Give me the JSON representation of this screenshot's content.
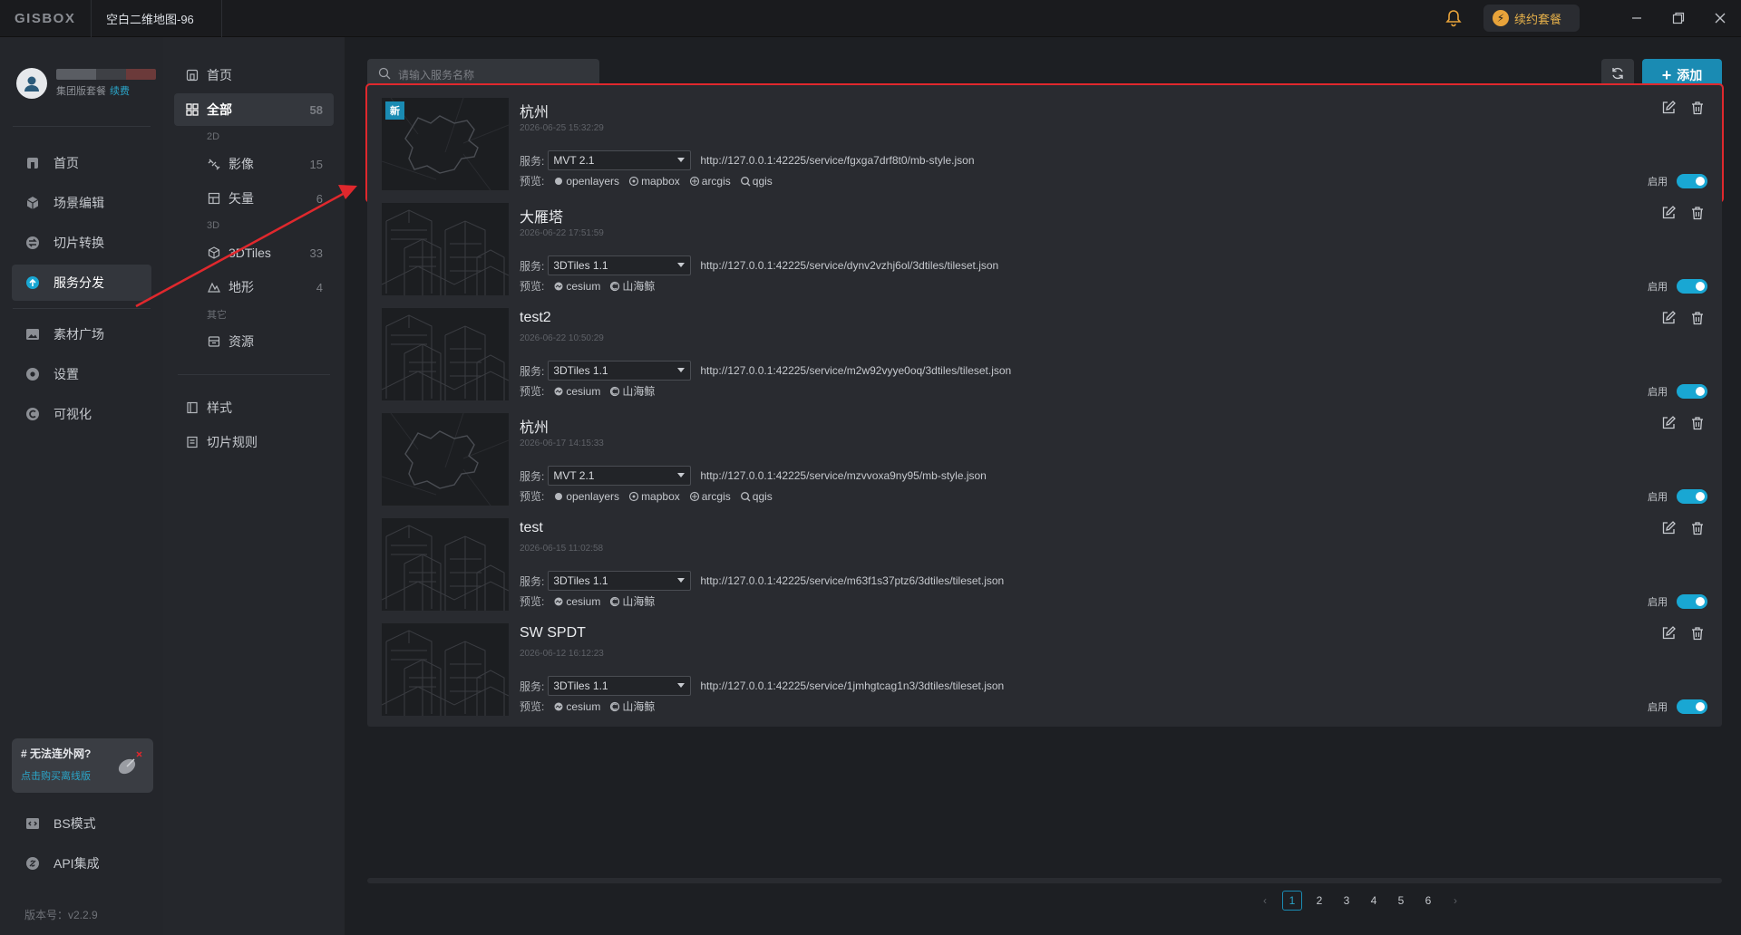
{
  "titlebar": {
    "logo": "GISBOX",
    "doc_tab": "空白二维地图-96",
    "renew_label": "续约套餐"
  },
  "user": {
    "plan": "集团版套餐",
    "renew_link": "续费"
  },
  "leftnav": {
    "items": [
      {
        "label": "首页",
        "icon": "home-icon"
      },
      {
        "label": "场景编辑",
        "icon": "cube-icon"
      },
      {
        "label": "切片转换",
        "icon": "swap-icon"
      },
      {
        "label": "服务分发",
        "icon": "upload-cloud-icon"
      },
      {
        "label": "素材广场",
        "icon": "image-icon"
      },
      {
        "label": "设置",
        "icon": "gear-icon"
      },
      {
        "label": "可视化",
        "icon": "chart-icon"
      }
    ],
    "bottom_items": [
      {
        "label": "BS模式",
        "icon": "code-icon"
      },
      {
        "label": "API集成",
        "icon": "link-icon"
      }
    ],
    "offline_card": {
      "title": "# 无法连外网?",
      "link": "点击购买离线版"
    },
    "version": "版本号：v2.2.9"
  },
  "categories": {
    "home": "首页",
    "all": {
      "label": "全部",
      "count": "58"
    },
    "group_2d": "2D",
    "imagery": {
      "label": "影像",
      "count": "15"
    },
    "vector": {
      "label": "矢量",
      "count": "6"
    },
    "group_3d": "3D",
    "tiles3d": {
      "label": "3DTiles",
      "count": "33"
    },
    "terrain": {
      "label": "地形",
      "count": "4"
    },
    "group_other": "其它",
    "resource": {
      "label": "资源"
    },
    "style": "样式",
    "tile_rules": "切片规则"
  },
  "toolbar": {
    "search_placeholder": "请输入服务名称",
    "add_label": "添加"
  },
  "labels": {
    "service": "服务:",
    "preview": "预览:",
    "enable": "启用"
  },
  "services": [
    {
      "title": "杭州",
      "date": "2026-06-25 15:32:29",
      "type": "MVT 2.1",
      "thumb": "map",
      "url": "http://127.0.0.1:42225/service/fgxga7drf8t0/mb-style.json",
      "previews": [
        "openlayers",
        "mapbox",
        "arcgis",
        "qgis"
      ],
      "is_new": true,
      "enabled": true
    },
    {
      "title": "大雁塔",
      "date": "2026-06-22 17:51:59",
      "type": "3DTiles 1.1",
      "thumb": "city",
      "url": "http://127.0.0.1:42225/service/dynv2vzhj6ol/3dtiles/tileset.json",
      "previews": [
        "cesium",
        "山海鲸"
      ],
      "is_new": false,
      "enabled": true
    },
    {
      "title": "test2",
      "date": "2026-06-22 10:50:29",
      "type": "3DTiles 1.1",
      "thumb": "city",
      "url": "http://127.0.0.1:42225/service/m2w92vyye0oq/3dtiles/tileset.json",
      "previews": [
        "cesium",
        "山海鲸"
      ],
      "is_new": false,
      "enabled": true
    },
    {
      "title": "杭州",
      "date": "2026-06-17 14:15:33",
      "type": "MVT 2.1",
      "thumb": "map",
      "url": "http://127.0.0.1:42225/service/mzvvoxa9ny95/mb-style.json",
      "previews": [
        "openlayers",
        "mapbox",
        "arcgis",
        "qgis"
      ],
      "is_new": false,
      "enabled": true
    },
    {
      "title": "test",
      "date": "2026-06-15 11:02:58",
      "type": "3DTiles 1.1",
      "thumb": "city",
      "url": "http://127.0.0.1:42225/service/m63f1s37ptz6/3dtiles/tileset.json",
      "previews": [
        "cesium",
        "山海鲸"
      ],
      "is_new": false,
      "enabled": true
    },
    {
      "title": "SW SPDT",
      "date": "2026-06-12 16:12:23",
      "type": "3DTiles 1.1",
      "thumb": "city",
      "url": "http://127.0.0.1:42225/service/1jmhgtcag1n3/3dtiles/tileset.json",
      "previews": [
        "cesium",
        "山海鲸"
      ],
      "is_new": false,
      "enabled": true
    }
  ],
  "pagination": {
    "pages": [
      "1",
      "2",
      "3",
      "4",
      "5",
      "6"
    ],
    "current": "1"
  },
  "colors": {
    "accent": "#1a8bb3",
    "toggle_on": "#19a7d3",
    "highlight": "#e0282d",
    "warning": "#e8a33a"
  }
}
